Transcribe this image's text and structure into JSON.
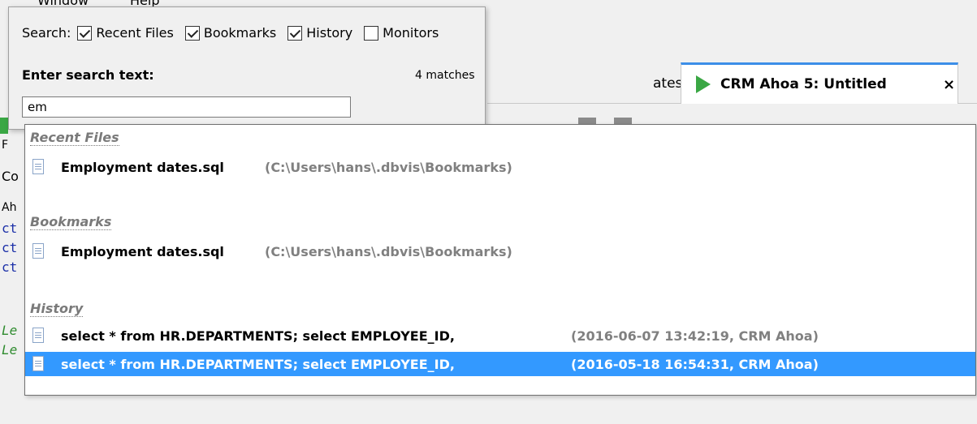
{
  "menu": {
    "window": "Window",
    "help": "Help"
  },
  "editor_tabs": [
    {
      "label": "ates.sql",
      "close": "×"
    },
    {
      "label": "CRM Ahoa 5: Untitled",
      "close": "×"
    }
  ],
  "left_strip": {
    "f": "F",
    "co": "Co",
    "ah": "Ah",
    "code_lines": [
      "ct",
      "ct",
      "ct"
    ],
    "green_lines": [
      "Le",
      "Le"
    ]
  },
  "search": {
    "scope_label": "Search:",
    "scopes": [
      {
        "label": "Recent Files",
        "checked": true
      },
      {
        "label": "Bookmarks",
        "checked": true
      },
      {
        "label": "History",
        "checked": true
      },
      {
        "label": "Monitors",
        "checked": false
      }
    ],
    "title": "Enter search text:",
    "match_count": "4 matches",
    "input_value": "em"
  },
  "results": {
    "groups": [
      {
        "heading": "Recent Files",
        "items": [
          {
            "title": "Employment dates.sql",
            "detail": "(C:\\Users\\hans\\.dbvis\\Bookmarks)",
            "selected": false
          }
        ]
      },
      {
        "heading": "Bookmarks",
        "items": [
          {
            "title": "Employment dates.sql",
            "detail": "(C:\\Users\\hans\\.dbvis\\Bookmarks)",
            "selected": false
          }
        ]
      },
      {
        "heading": "History",
        "items": [
          {
            "title": "select * from HR.DEPARTMENTS; select EMPLOYEE_ID,",
            "detail": "(2016-06-07 13:42:19,  CRM Ahoa)",
            "selected": false
          },
          {
            "title": "select * from HR.DEPARTMENTS; select EMPLOYEE_ID,",
            "detail": "(2016-05-18 16:54:31,  CRM Ahoa)",
            "selected": true
          }
        ]
      }
    ]
  },
  "colors": {
    "selection": "#3399ff",
    "active_tab_accent": "#3c8ee8",
    "play": "#3aa744"
  },
  "icons": {
    "result_item": "document-icon",
    "tab_run": "play-icon"
  }
}
